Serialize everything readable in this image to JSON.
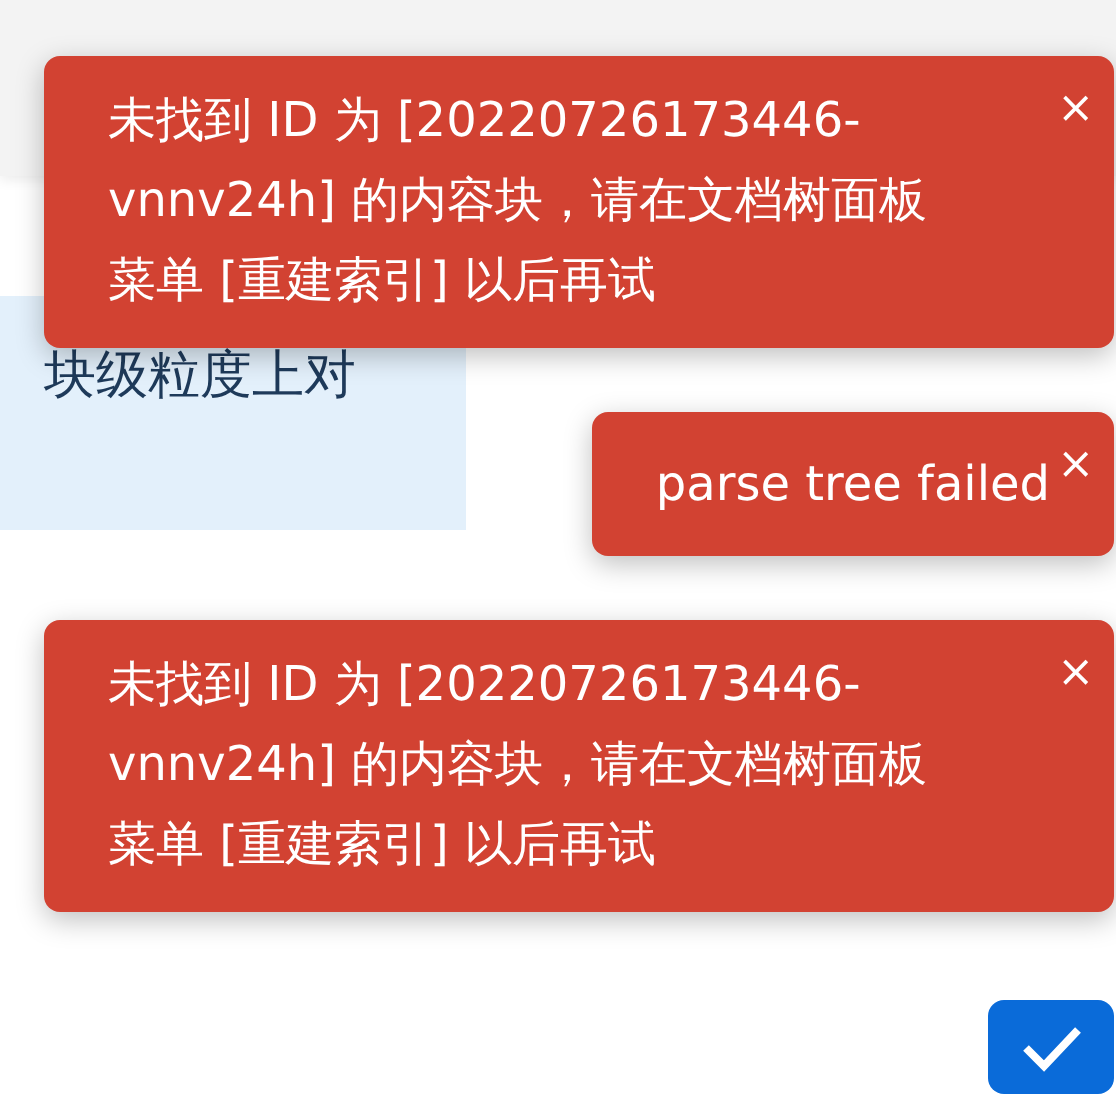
{
  "document": {
    "quote_text": "块级粒度上对"
  },
  "toasts": [
    {
      "lines": [
        "未找到 ID 为 [20220726173446-",
        "vnnv24h] 的内容块，请在文档树面板",
        "菜单 [重建索引] 以后再试"
      ],
      "close": "×"
    },
    {
      "lines": [
        "parse tree failed"
      ],
      "close": "×"
    },
    {
      "lines": [
        "未找到 ID 为 [20220726173446-",
        "vnnv24h] 的内容块，请在文档树面板",
        "菜单 [重建索引] 以后再试"
      ],
      "close": "×"
    }
  ]
}
